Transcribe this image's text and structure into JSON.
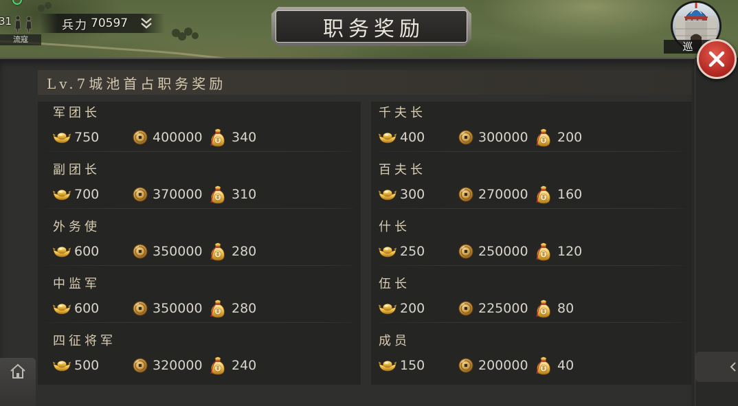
{
  "hud": {
    "army_count": "31",
    "troops_label": "兵力",
    "troops_value": "70597",
    "bandit_label": "流寇",
    "patrol_label": "巡"
  },
  "title": "职务奖励",
  "header": "Lv.7城池首占职务奖励",
  "icons": {
    "status": "green-ring-icon",
    "soldiers": "soldiers-icon",
    "troops_toggle": "double-chevron-down-icon",
    "city": "castle-icon",
    "close": "close-icon",
    "home": "home-icon",
    "side_tab": "chevron-left-icon",
    "reward_ingot": "gold-ingot-icon",
    "reward_coin": "copper-coin-icon",
    "reward_pouch": "treasure-pouch-icon"
  },
  "colors": {
    "panel_background": "#2f2f2d",
    "column_background": "#252523",
    "rank_text": "#d8ccb3",
    "value_text": "#d9d5cc",
    "title_text": "#ebe7dd",
    "close_button": "#c8342c",
    "ingot_gold": "#f0c04a",
    "status_ring": "#4fd16a"
  },
  "columns": [
    {
      "entries": [
        {
          "title": "军团长",
          "ingot": "750",
          "coin": "400000",
          "pouch": "340"
        },
        {
          "title": "副团长",
          "ingot": "700",
          "coin": "370000",
          "pouch": "310"
        },
        {
          "title": "外务使",
          "ingot": "600",
          "coin": "350000",
          "pouch": "280"
        },
        {
          "title": "中监军",
          "ingot": "600",
          "coin": "350000",
          "pouch": "280"
        },
        {
          "title": "四征将军",
          "ingot": "500",
          "coin": "320000",
          "pouch": "240"
        }
      ]
    },
    {
      "entries": [
        {
          "title": "千夫长",
          "ingot": "400",
          "coin": "300000",
          "pouch": "200"
        },
        {
          "title": "百夫长",
          "ingot": "300",
          "coin": "270000",
          "pouch": "160"
        },
        {
          "title": "什长",
          "ingot": "250",
          "coin": "250000",
          "pouch": "120"
        },
        {
          "title": "伍长",
          "ingot": "200",
          "coin": "225000",
          "pouch": "80"
        },
        {
          "title": "成员",
          "ingot": "150",
          "coin": "200000",
          "pouch": "40"
        }
      ]
    }
  ]
}
